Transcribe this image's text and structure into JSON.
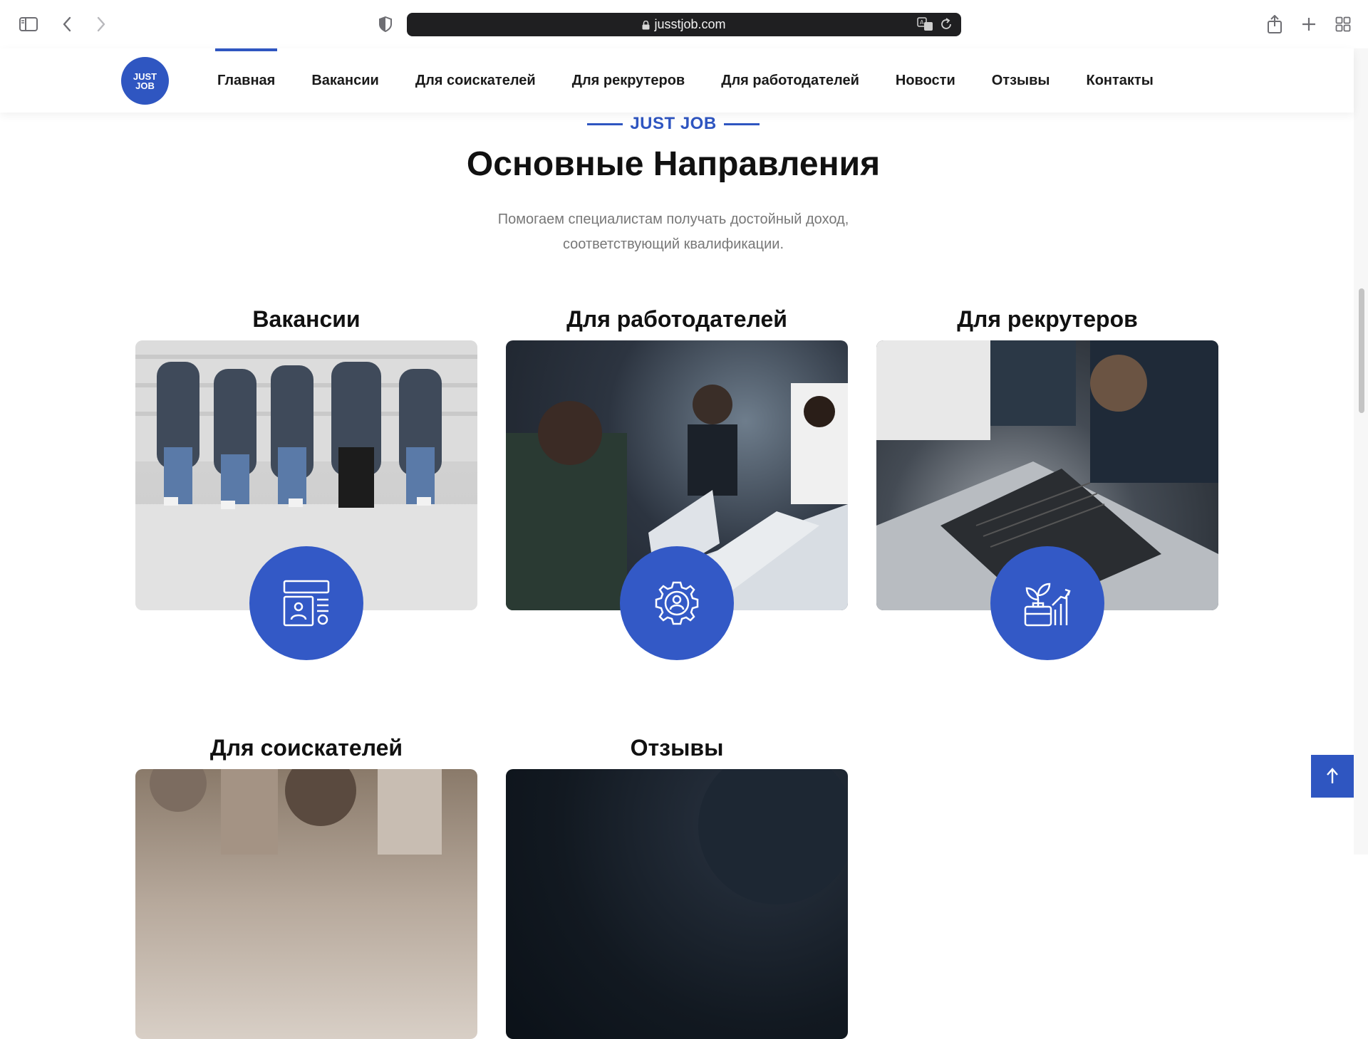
{
  "browser": {
    "url": "jusstjob.com"
  },
  "header": {
    "logo_text": "JUST JOB",
    "nav": [
      {
        "label": "Главная",
        "active": true
      },
      {
        "label": "Вакансии",
        "active": false
      },
      {
        "label": "Для соискателей",
        "active": false
      },
      {
        "label": "Для рекрутеров",
        "active": false
      },
      {
        "label": "Для работодателей",
        "active": false
      },
      {
        "label": "Новости",
        "active": false
      },
      {
        "label": "Отзывы",
        "active": false
      },
      {
        "label": "Контакты",
        "active": false
      }
    ]
  },
  "section": {
    "eyebrow": "JUST JOB",
    "title": "Основные Направления",
    "subtitle_line1": "Помогаем специалистам получать достойный доход,",
    "subtitle_line2": "соответствующий квалификации."
  },
  "cards": [
    {
      "title": "Вакансии",
      "icon": "resume-icon"
    },
    {
      "title": "Для работодателей",
      "icon": "gear-person-icon"
    },
    {
      "title": "Для рекрутеров",
      "icon": "growth-briefcase-icon"
    },
    {
      "title": "Для соискателей",
      "icon": ""
    },
    {
      "title": "Отзывы",
      "icon": ""
    }
  ],
  "colors": {
    "accent": "#2f56c1"
  },
  "back_to_top": {
    "icon": "arrow-up-icon"
  }
}
